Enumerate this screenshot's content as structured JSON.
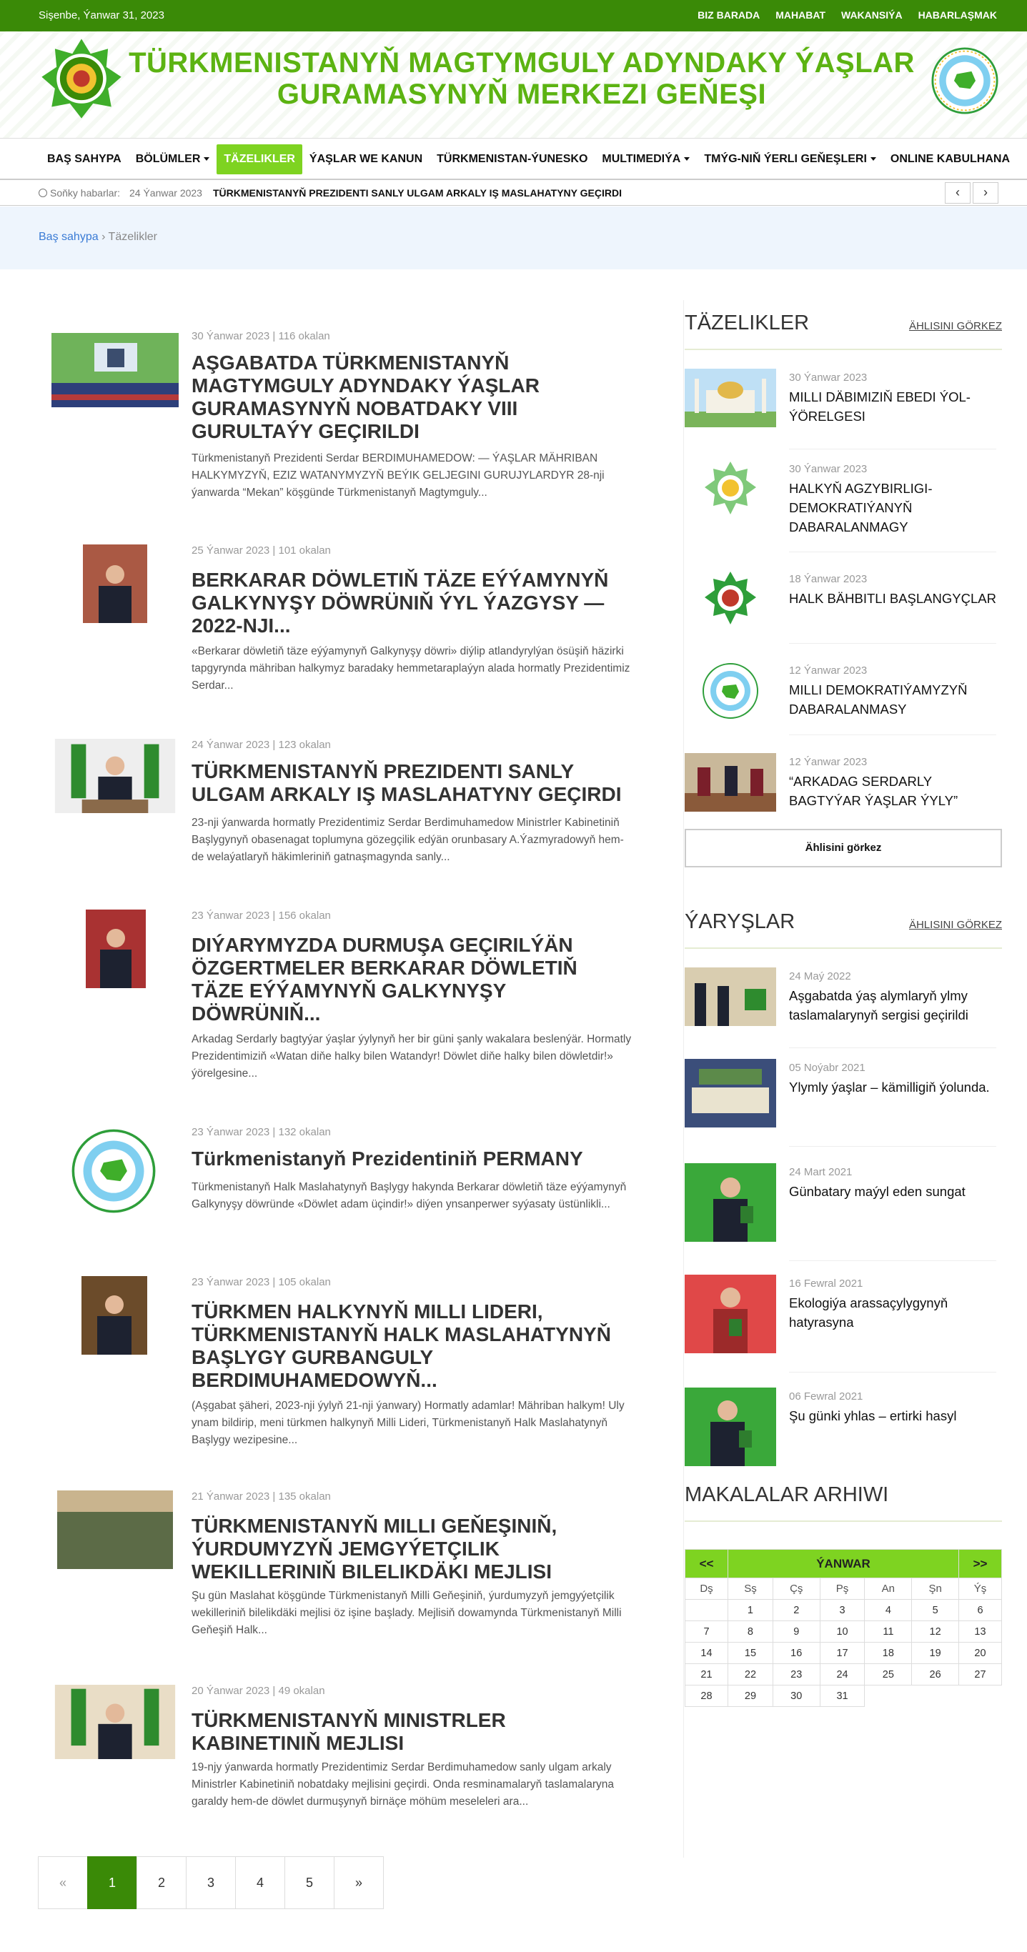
{
  "topbar": {
    "date": "Sişenbe, Ýanwar 31, 2023",
    "links": [
      "BIZ BARADA",
      "MAHABAT",
      "WAKANSIÝA",
      "HABARLAŞMAK"
    ]
  },
  "header": {
    "title_line1": "TÜRKMENISTANYŇ MAGTYMGULY ADYNDAKY ÝAŞLAR",
    "title_line2": "GURAMASYNYŇ MERKEZI GEŇEŞI",
    "logo_left_icon": "star-emblem-icon",
    "logo_right_icon": "round-seal-icon",
    "brand_color": "#5cb312"
  },
  "nav": {
    "items": [
      {
        "label": "BAŞ SAHYPA",
        "dropdown": false
      },
      {
        "label": "BÖLÜMLER",
        "dropdown": true
      },
      {
        "label": "TÄZELIKLER",
        "dropdown": false,
        "active": true
      },
      {
        "label": "ÝAŞLAR WE KANUN",
        "dropdown": false
      },
      {
        "label": "TÜRKMENISTAN-ÝUNESKO",
        "dropdown": false
      },
      {
        "label": "MULTIMEDIÝA",
        "dropdown": true
      },
      {
        "label": "TMÝG-NIŇ ÝERLI GEŇEŞLERI",
        "dropdown": true
      },
      {
        "label": "ONLINE KABULHANA",
        "dropdown": false
      }
    ]
  },
  "ticker": {
    "label": "Soňky habarlar:",
    "date": "24 Ýanwar 2023",
    "text": "TÜRKMENISTANYŇ PREZIDENTI SANLY ULGAM ARKALY IŞ MASLAHATYNY GEÇIRDI",
    "prev_icon": "chevron-left-icon",
    "next_icon": "chevron-right-icon"
  },
  "breadcrumb": {
    "home": "Baş sahypa",
    "separator": "›",
    "current": "Täzelikler"
  },
  "articles": [
    {
      "meta": "30 Ýanwar 2023 | 116 okalan",
      "title": "AŞGABATDA TÜRKMENISTANYŇ MAGTYMGULY ADYNDAKY ÝAŞLAR GURAMASYNYŇ NOBATDAKY VIII GURULTAÝY GEÇIRILDI",
      "excerpt": "Türkmenistanyň Prezidenti Serdar BERDIMUHAMEDOW: — ÝAŞLAR MÄHRIBAN HALKYMYZYŇ, EZIZ WATANYMYZYŇ BEÝIK GELJEGINI GURUJYLARDYR   28-nji ýanwarda “Mekan” köşgünde Türkmenistanyň Magtymguly..."
    },
    {
      "meta": "25 Ýanwar 2023 | 101 okalan",
      "title": "BERKARAR DÖWLETIŇ TÄZE EÝÝAMYNYŇ GALKYNYŞY DÖWRÜNIŇ ÝYL ÝAZGYSY — 2022-NJI...",
      "excerpt": "«Berkarar döwletiň täze eýýamynyň Galkynyşy döwri» diýlip atlandyrylýan ösüşiň häzirki tapgyrynda mähriban halkymyz baradaky hemmetaraplaýyn alada hormatly Prezidentimiz Serdar..."
    },
    {
      "meta": "24 Ýanwar 2023 | 123 okalan",
      "title": "TÜRKMENISTANYŇ PREZIDENTI SANLY ULGAM ARKALY IŞ MASLAHATYNY GEÇIRDI",
      "excerpt": "23-nji ýanwarda hormatly Prezidentimiz Serdar Berdimuhamedow Ministrler Kabinetiniň Başlygynyň obasenagat toplumyna gözegçilik edýän orunbasary A.Ýazmyradowyň hem-de welaýatlaryň häkimleriniň gatnaşmagynda sanly..."
    },
    {
      "meta": "23 Ýanwar 2023 | 156 okalan",
      "title": "DIÝARYMYZDA DURMUŞA GEÇIRILÝÄN ÖZGERTMELER BERKARAR DÖWLETIŇ TÄZE EÝÝAMYNYŇ GALKYNYŞY DÖWRÜNIŇ...",
      "excerpt": "Arkadag Serdarly bagtyýar ýaşlar ýylynyň her bir güni şanly wakalara beslenýär. Hormatly Prezidentimiziň «Watan diňe halky bilen Watandyr! Döwlet diňe halky bilen döwletdir!» ýörelgesine..."
    },
    {
      "meta": "23 Ýanwar 2023 | 132 okalan",
      "title": "Türkmenistanyň Prezidentiniň PERMANY",
      "excerpt": "Türkmenistanyň Halk Maslahatynyň Başlygy hakynda Berkarar döwletiň täze eýýamynyň Galkynyşy döwründe «Döwlet adam üçindir!» diýen ynsanperwer syýasaty üstünlikli..."
    },
    {
      "meta": "23 Ýanwar 2023 | 105 okalan",
      "title": "TÜRKMEN HALKYNYŇ MILLI LIDERI, TÜRKMENISTANYŇ HALK MASLAHATYNYŇ BAŞLYGY GURBANGULY BERDIMUHAMEDOWYŇ...",
      "excerpt": "(Aşgabat şäheri, 2023-nji ýylyň 21-nji ýanwary)   Hormatly adamlar! Mähriban halkym! Uly ynam bildirip, meni türkmen halkynyň Milli Lideri, Türkmenistanyň Halk Maslahatynyň Başlygy wezipesine..."
    },
    {
      "meta": "21 Ýanwar 2023 | 135 okalan",
      "title": "TÜRKMENISTANYŇ MILLI GEŇEŞINIŇ, ÝURDUMYZYŇ JEMGYÝETÇILIK WEKILLERINIŇ BILELIKDÄKI MEJLISI",
      "excerpt": "Şu gün Maslahat köşgünde Türkmenistanyň Milli Geňeşiniň, ýurdumyzyň jemgyýetçilik wekilleriniň bilelikdäki mejlisi öz işine başlady. Mejlisiň dowamynda Türkmenistanyň Milli Geňeşiň Halk..."
    },
    {
      "meta": "20 Ýanwar 2023 | 49 okalan",
      "title": "TÜRKMENISTANYŇ MINISTRLER KABINETINIŇ MEJLISI",
      "excerpt": "19-njy ýanwarda hormatly Prezidentimiz Serdar Berdimuhamedow sanly ulgam arkaly Ministrler Kabinetiniň nobatdaky mejlisini geçirdi. Onda resminamalaryň taslamalaryna garaldy hem-de döwlet durmuşynyň birnäçe möhüm meseleleri ara..."
    }
  ],
  "pagination": {
    "prev": "«",
    "pages": [
      "1",
      "2",
      "3",
      "4",
      "5"
    ],
    "current": "1",
    "next": "»"
  },
  "sidebar": {
    "news": {
      "heading": "TÄZELIKLER",
      "more": "ÄHLISINI GÖRKEZ",
      "items": [
        {
          "date": "30 Ýanwar 2023",
          "title": "MILLI DÄBIMIZIŇ EBEDI ÝOL-ÝÖRELGESI"
        },
        {
          "date": "30 Ýanwar 2023",
          "title": "HALKYŇ AGZYBIRLIGI-DEMOKRATIÝANYŇ DABARALANMAGY"
        },
        {
          "date": "18 Ýanwar 2023",
          "title": "HALK BÄHBITLI BAŞLANGYÇLAR"
        },
        {
          "date": "12 Ýanwar 2023",
          "title": "MILLI DEMOKRATIÝAMYZYŇ DABARALANMASY"
        },
        {
          "date": "12 Ýanwar 2023",
          "title": "“ARKADAG SERDARLY BAGTYÝAR ÝAŞLAR ÝYLY”"
        }
      ],
      "view_all": "Ählisini görkez"
    },
    "contests": {
      "heading": "ÝARYŞLAR",
      "more": "ÄHLISINI GÖRKEZ",
      "items": [
        {
          "date": "24 Maý 2022",
          "title": "Aşgabatda ýaş alymlaryň ylmy taslamalarynyň sergisi geçirildi"
        },
        {
          "date": "05 Noýabr 2021",
          "title": "Ylymly ýaşlar – kämilligiň ýolunda."
        },
        {
          "date": "24 Mart 2021",
          "title": "Günbatary maýyl eden sungat"
        },
        {
          "date": "16 Fewral 2021",
          "title": "Ekologiýa arassaçylygynyň hatyrasyna"
        },
        {
          "date": "06 Fewral 2021",
          "title": "Şu günki yhlas – ertirki hasyl"
        }
      ]
    },
    "archive": {
      "heading": "MAKALALAR ARHIWI",
      "prev": "<<",
      "month": "ÝANWAR",
      "next": ">>",
      "weekdays": [
        "Dş",
        "Sş",
        "Çş",
        "Pş",
        "An",
        "Şn",
        "Ýş"
      ],
      "weeks": [
        [
          "",
          "1",
          "2",
          "3",
          "4",
          "5",
          "6"
        ],
        [
          "7",
          "8",
          "9",
          "10",
          "11",
          "12",
          "13"
        ],
        [
          "14",
          "15",
          "16",
          "17",
          "18",
          "19",
          "20"
        ],
        [
          "21",
          "22",
          "23",
          "24",
          "25",
          "26",
          "27"
        ],
        [
          "28",
          "29",
          "30",
          "31",
          "",
          "",
          ""
        ]
      ]
    }
  }
}
